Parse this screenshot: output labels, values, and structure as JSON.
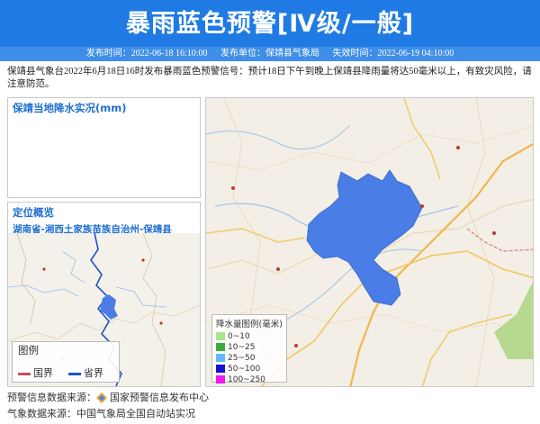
{
  "header": {
    "title": "暴雨蓝色预警[Ⅳ级/一般]",
    "publish_time": "发布时间：2022-06-18 16:10:00",
    "publisher": "发布单位：保靖县气象局",
    "expire_time": "失效时间：2022-06-19 04:10:00"
  },
  "notice": "保靖县气象台2022年6月18日16时发布暴雨蓝色预警信号：预计18日下午到晚上保靖县降雨量将达50毫米以上，有致灾风险，请注意防范。",
  "rain_panel": {
    "title": "保靖当地降水实况(mm)"
  },
  "location_panel": {
    "title": "定位概览",
    "region": "湖南省-湘西土家族苗族自治州-保靖县",
    "legend": {
      "title": "图例",
      "items": [
        {
          "label": "国界",
          "color": "#c4515e"
        },
        {
          "label": "省界",
          "color": "#1d52c9"
        }
      ]
    }
  },
  "map": {
    "warning_area_color": "#4a7de6",
    "rain_legend": {
      "title": "降水量图例(毫米)",
      "items": [
        {
          "label": "0~10",
          "color": "#a6e58a"
        },
        {
          "label": "10~25",
          "color": "#3daa3d"
        },
        {
          "label": "25~50",
          "color": "#62b8ff"
        },
        {
          "label": "50~100",
          "color": "#1411d4"
        },
        {
          "label": "100~250",
          "color": "#f216f0"
        }
      ]
    }
  },
  "sources": {
    "warning_source": "预警信息数据来源：",
    "warning_org": "国家预警信息发布中心",
    "weather_source": "气象数据来源：中国气象局全国自动站实况"
  }
}
